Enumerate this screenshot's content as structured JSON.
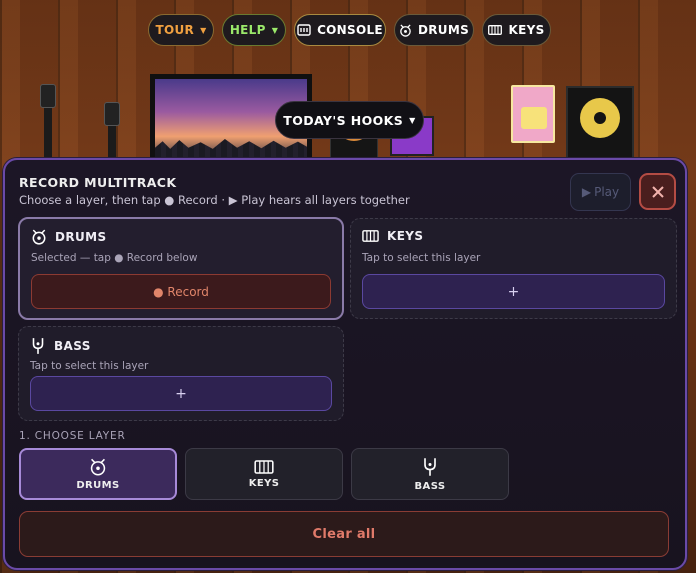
{
  "toolbar": {
    "tour_label": "TOUR",
    "help_label": "HELP",
    "console_label": "CONSOLE",
    "drums_label": "DRUMS",
    "keys_label": "KEYS",
    "hooks_label": "TODAY'S HOOKS"
  },
  "panel": {
    "title": "RECORD MULTITRACK",
    "subtitle": "Choose a layer, then tap ● Record · ▶ Play hears all layers together",
    "play_label": "Play",
    "layers": [
      {
        "name": "DRUMS",
        "note": "Selected — tap ● Record below",
        "action": "● Record",
        "icon": "drum-icon"
      },
      {
        "name": "KEYS",
        "note": "Tap to select this layer",
        "action": "+",
        "icon": "keyboard-icon"
      },
      {
        "name": "BASS",
        "note": "Tap to select this layer",
        "action": "+",
        "icon": "bass-icon"
      }
    ],
    "choose_label": "1. CHOOSE LAYER",
    "choose": [
      {
        "label": "DRUMS",
        "icon": "drum-icon"
      },
      {
        "label": "KEYS",
        "icon": "keyboard-icon"
      },
      {
        "label": "BASS",
        "icon": "bass-icon"
      }
    ],
    "clear_label": "Clear all"
  },
  "colors": {
    "accent_purple": "#a78ad8",
    "record_red": "#8c3a32",
    "tour_orange": "#f0a040",
    "help_green": "#9be86a"
  }
}
